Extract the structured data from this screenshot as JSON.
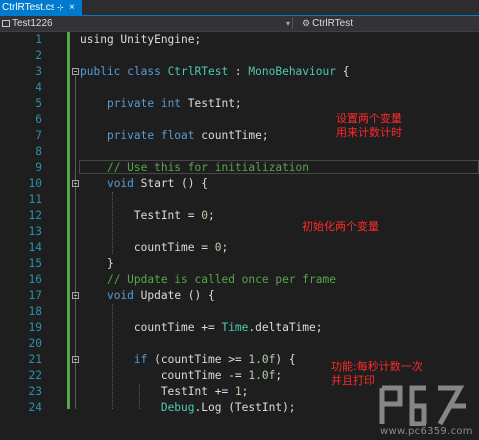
{
  "tab": {
    "label": "CtrlRTest.cs",
    "pin": "⊹",
    "close": "×"
  },
  "navbar": {
    "project": "Test1226",
    "class_name": "CtrlRTest",
    "dropdown": "▾"
  },
  "lines": [
    {
      "n": "1",
      "code": [
        [
          "pl",
          "using UnityEngine;"
        ]
      ]
    },
    {
      "n": "2",
      "code": []
    },
    {
      "n": "3",
      "code": [
        [
          "kw",
          "public class "
        ],
        [
          "ty",
          "CtrlRTest"
        ],
        [
          "pl",
          " : "
        ],
        [
          "ty",
          "MonoBehaviour"
        ],
        [
          "pl",
          " {"
        ]
      ]
    },
    {
      "n": "4",
      "code": []
    },
    {
      "n": "5",
      "code": [
        [
          "pl",
          "    "
        ],
        [
          "kw",
          "private int"
        ],
        [
          "pl",
          " TestInt;"
        ]
      ]
    },
    {
      "n": "6",
      "code": []
    },
    {
      "n": "7",
      "code": [
        [
          "pl",
          "    "
        ],
        [
          "kw",
          "private float"
        ],
        [
          "pl",
          " countTime;"
        ]
      ]
    },
    {
      "n": "8",
      "code": []
    },
    {
      "n": "9",
      "code": [
        [
          "pl",
          "    "
        ],
        [
          "cm",
          "// Use this for initialization"
        ]
      ]
    },
    {
      "n": "10",
      "code": [
        [
          "pl",
          "    "
        ],
        [
          "kw",
          "void"
        ],
        [
          "pl",
          " Start () {"
        ]
      ]
    },
    {
      "n": "11",
      "code": []
    },
    {
      "n": "12",
      "code": [
        [
          "pl",
          "        TestInt = "
        ],
        [
          "nu",
          "0"
        ],
        [
          "pl",
          ";"
        ]
      ]
    },
    {
      "n": "13",
      "code": []
    },
    {
      "n": "14",
      "code": [
        [
          "pl",
          "        countTime = "
        ],
        [
          "nu",
          "0"
        ],
        [
          "pl",
          ";"
        ]
      ]
    },
    {
      "n": "15",
      "code": [
        [
          "pl",
          "    }"
        ]
      ]
    },
    {
      "n": "16",
      "code": [
        [
          "pl",
          "    "
        ],
        [
          "cm",
          "// Update is called once per frame"
        ]
      ]
    },
    {
      "n": "17",
      "code": [
        [
          "pl",
          "    "
        ],
        [
          "kw",
          "void"
        ],
        [
          "pl",
          " Update () {"
        ]
      ]
    },
    {
      "n": "18",
      "code": []
    },
    {
      "n": "19",
      "code": [
        [
          "pl",
          "        countTime += "
        ],
        [
          "ty",
          "Time"
        ],
        [
          "pl",
          ".deltaTime;"
        ]
      ]
    },
    {
      "n": "20",
      "code": []
    },
    {
      "n": "21",
      "code": [
        [
          "pl",
          "        "
        ],
        [
          "kw",
          "if"
        ],
        [
          "pl",
          " (countTime >= "
        ],
        [
          "nu",
          "1.0f"
        ],
        [
          "pl",
          ") {"
        ]
      ]
    },
    {
      "n": "22",
      "code": [
        [
          "pl",
          "            countTime -= "
        ],
        [
          "nu",
          "1.0f"
        ],
        [
          "pl",
          ";"
        ]
      ]
    },
    {
      "n": "23",
      "code": [
        [
          "pl",
          "            TestInt += "
        ],
        [
          "nu",
          "1"
        ],
        [
          "pl",
          ";"
        ]
      ]
    },
    {
      "n": "24",
      "code": [
        [
          "pl",
          "            "
        ],
        [
          "ty",
          "Debug"
        ],
        [
          "pl",
          ".Log (TestInt);"
        ]
      ]
    }
  ],
  "annotations": {
    "vars": "设置两个变量\n用来计数计时",
    "init": "初始化两个变量",
    "func": "功能:每秒计数一次\n并且打印"
  },
  "watermark": {
    "url": "www.pc6359.com"
  },
  "colors": {
    "keyword": "#569cd6",
    "type": "#4ec9b0",
    "comment": "#57a64a",
    "number": "#b5cea8",
    "annotation": "#ff2a2a",
    "tab": "#007acc"
  }
}
